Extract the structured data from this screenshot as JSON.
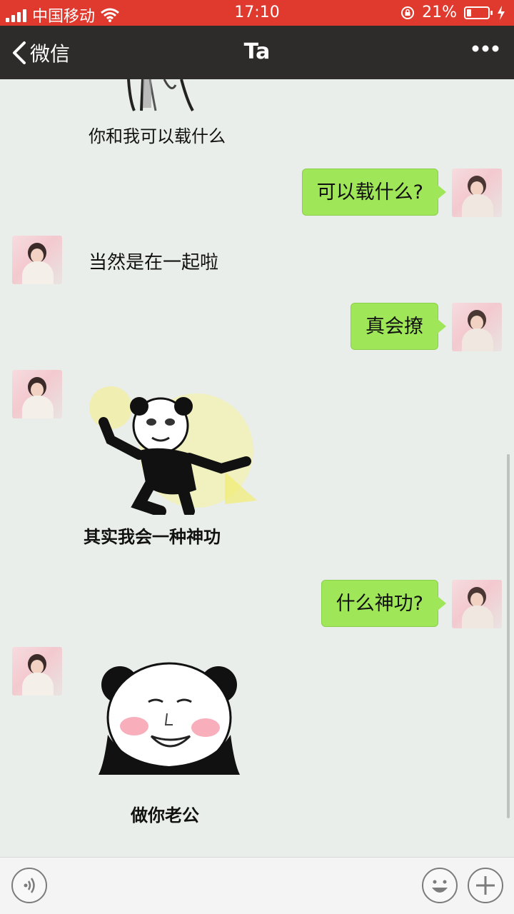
{
  "status_bar": {
    "carrier": "中国移动",
    "time": "17:10",
    "battery": "21%",
    "battery_level": 0.21,
    "icons": [
      "signal-icon",
      "wifi-icon",
      "rotation-lock-icon",
      "battery-icon",
      "charging-icon"
    ]
  },
  "nav": {
    "back_label": "微信",
    "title": "Ta",
    "more_icon": "more-icon"
  },
  "messages": [
    {
      "side": "in",
      "type": "sticker-caption",
      "text": "你和我可以载什么"
    },
    {
      "side": "out",
      "type": "text",
      "text": "可以载什么?"
    },
    {
      "side": "in",
      "type": "text",
      "text": "当然是在一起啦"
    },
    {
      "side": "out",
      "type": "text",
      "text": "真会撩"
    },
    {
      "side": "in",
      "type": "sticker",
      "caption": "其实我会一种神功"
    },
    {
      "side": "out",
      "type": "text",
      "text": "什么神功?"
    },
    {
      "side": "in",
      "type": "sticker",
      "caption": "做你老公"
    }
  ],
  "bottom_bar": {
    "icons": [
      "voice-icon",
      "emoji-icon",
      "plus-icon"
    ]
  },
  "colors": {
    "status_bar": "#e03a2f",
    "nav_bar": "#2e2b2b",
    "chat_bg": "#eaeeea",
    "outgoing_bubble": "#9fe658"
  }
}
